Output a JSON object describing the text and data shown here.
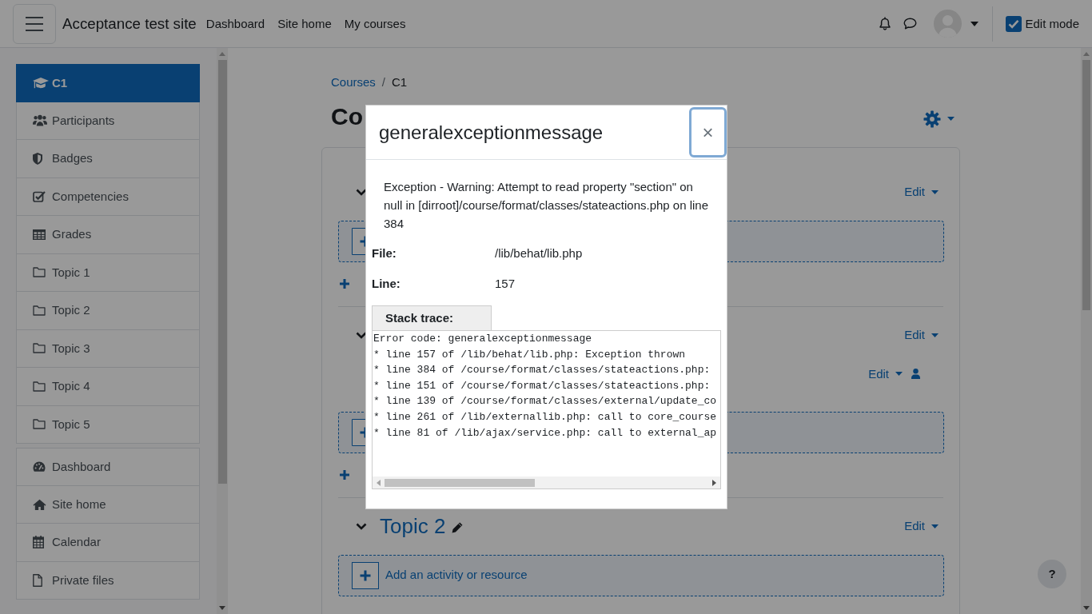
{
  "topbar": {
    "site_name": "Acceptance test site",
    "nav": [
      {
        "label": "Dashboard"
      },
      {
        "label": "Site home"
      },
      {
        "label": "My courses"
      }
    ],
    "edit_mode": {
      "label": "Edit mode",
      "checked": true
    }
  },
  "sidebar": {
    "groups": [
      {
        "items": [
          {
            "kind": "course",
            "label": "C1",
            "selected": true
          },
          {
            "kind": "participants",
            "label": "Participants",
            "selected": false
          },
          {
            "kind": "badges",
            "label": "Badges",
            "selected": false
          },
          {
            "kind": "competencies",
            "label": "Competencies",
            "selected": false
          },
          {
            "kind": "grades",
            "label": "Grades",
            "selected": false
          },
          {
            "kind": "section",
            "label": "Topic 1",
            "selected": false
          },
          {
            "kind": "section",
            "label": "Topic 2",
            "selected": false
          },
          {
            "kind": "section",
            "label": "Topic 3",
            "selected": false
          },
          {
            "kind": "section",
            "label": "Topic 4",
            "selected": false
          },
          {
            "kind": "section",
            "label": "Topic 5",
            "selected": false
          }
        ]
      },
      {
        "items": [
          {
            "kind": "dashboard",
            "label": "Dashboard",
            "selected": false
          },
          {
            "kind": "home",
            "label": "Site home",
            "selected": false
          },
          {
            "kind": "calendar",
            "label": "Calendar",
            "selected": false
          },
          {
            "kind": "files",
            "label": "Private files",
            "selected": false
          }
        ]
      }
    ]
  },
  "breadcrumb": {
    "items": [
      {
        "kind": "link",
        "label": "Courses"
      },
      {
        "kind": "current",
        "label": "C1"
      }
    ],
    "separator": "/"
  },
  "page_heading": "Co",
  "sections": [
    {
      "expanded": true,
      "edit_label": "Edit",
      "add_section_link": true
    },
    {
      "expanded": true,
      "edit_label": "Edit",
      "activities": [
        {
          "edit_label": "Edit"
        }
      ],
      "add_section_link": true
    },
    {
      "expanded": true,
      "title": "Topic 2",
      "edit_label": "Edit",
      "add_activity_label": "Add an activity or resource"
    }
  ],
  "help_button": {
    "label": "?"
  },
  "dialog": {
    "title": "generalexceptionmessage",
    "close_label": "×",
    "message": "Exception - Warning: Attempt to read property \"section\" on null in [dirroot]/course/format/classes/stateactions.php on line 384",
    "details": [
      {
        "label": "File:",
        "value": "/lib/behat/lib.php"
      },
      {
        "label": "Line:",
        "value": "157"
      }
    ],
    "stack_trace": {
      "label": "Stack trace:",
      "lines": [
        "Error code: generalexceptionmessage",
        "* line 157 of /lib/behat/lib.php: Exception thrown",
        "* line 384 of /course/format/classes/stateactions.php:",
        "* line 151 of /course/format/classes/stateactions.php:",
        "* line 139 of /course/format/classes/external/update_co",
        "* line 261 of /lib/externallib.php: call to core_course",
        "* line 81 of /lib/ajax/service.php: call to external_ap"
      ]
    }
  }
}
